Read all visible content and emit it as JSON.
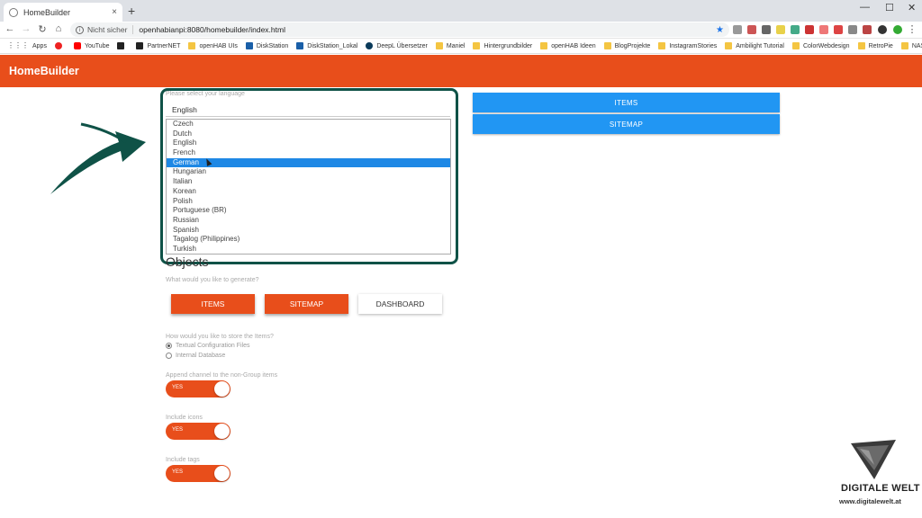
{
  "browser": {
    "tab_title": "HomeBuilder",
    "tab_close": "×",
    "new_tab": "+",
    "security_label": "Nicht sicher",
    "url": "openhabianpi:8080/homebuilder/index.html",
    "bookmarks": [
      {
        "label": "Apps",
        "icon": "apps-icon"
      },
      {
        "label": "",
        "icon": "pinterest-icon"
      },
      {
        "label": "YouTube",
        "icon": "youtube-icon"
      },
      {
        "label": "",
        "icon": "amazon-icon"
      },
      {
        "label": "PartnerNET",
        "icon": "amazon-icon"
      },
      {
        "label": "openHAB UIs",
        "icon": "folder-icon"
      },
      {
        "label": "DiskStation",
        "icon": "diskstation-icon"
      },
      {
        "label": "DiskStation_Lokal",
        "icon": "diskstation-icon"
      },
      {
        "label": "DeepL Übersetzer",
        "icon": "deepl-icon"
      },
      {
        "label": "Maniel",
        "icon": "folder-icon"
      },
      {
        "label": "Hintergrundbilder",
        "icon": "folder-icon"
      },
      {
        "label": "openHAB Ideen",
        "icon": "folder-icon"
      },
      {
        "label": "BlogProjekte",
        "icon": "folder-icon"
      },
      {
        "label": "InstagramStories",
        "icon": "folder-icon"
      },
      {
        "label": "Ambilight Tutorial",
        "icon": "folder-icon"
      },
      {
        "label": "ColorWebdesign",
        "icon": "folder-icon"
      },
      {
        "label": "RetroPie",
        "icon": "folder-icon"
      },
      {
        "label": "NAS",
        "icon": "folder-icon"
      }
    ]
  },
  "app": {
    "title": "HomeBuilder",
    "accent": "#e84e1b",
    "blue": "#2196f3"
  },
  "language": {
    "label": "Please select your language",
    "current": "English",
    "options": [
      "Czech",
      "Dutch",
      "English",
      "French",
      "German",
      "Hungarian",
      "Italian",
      "Korean",
      "Polish",
      "Portuguese (BR)",
      "Russian",
      "Spanish",
      "Tagalog (Philippines)",
      "Turkish"
    ],
    "hovered": "German"
  },
  "top_buttons": {
    "items": "ITEMS",
    "sitemap": "SITEMAP"
  },
  "objects": {
    "title": "Objects",
    "subtitle": "What would you like to generate?",
    "buttons": [
      "ITEMS",
      "SITEMAP",
      "DASHBOARD"
    ]
  },
  "storage": {
    "question": "How would you like to store the Items?",
    "options": [
      "Textual Configuration Files",
      "Internal Database"
    ],
    "selected": "Textual Configuration Files"
  },
  "toggles": [
    {
      "label": "Append channel to the non-Group items",
      "value": "YES"
    },
    {
      "label": "Include icons",
      "value": "YES"
    },
    {
      "label": "Include tags",
      "value": "YES"
    }
  ],
  "watermark": {
    "name": "DIGITALE WELT",
    "url": "www.digitalewelt.at"
  }
}
